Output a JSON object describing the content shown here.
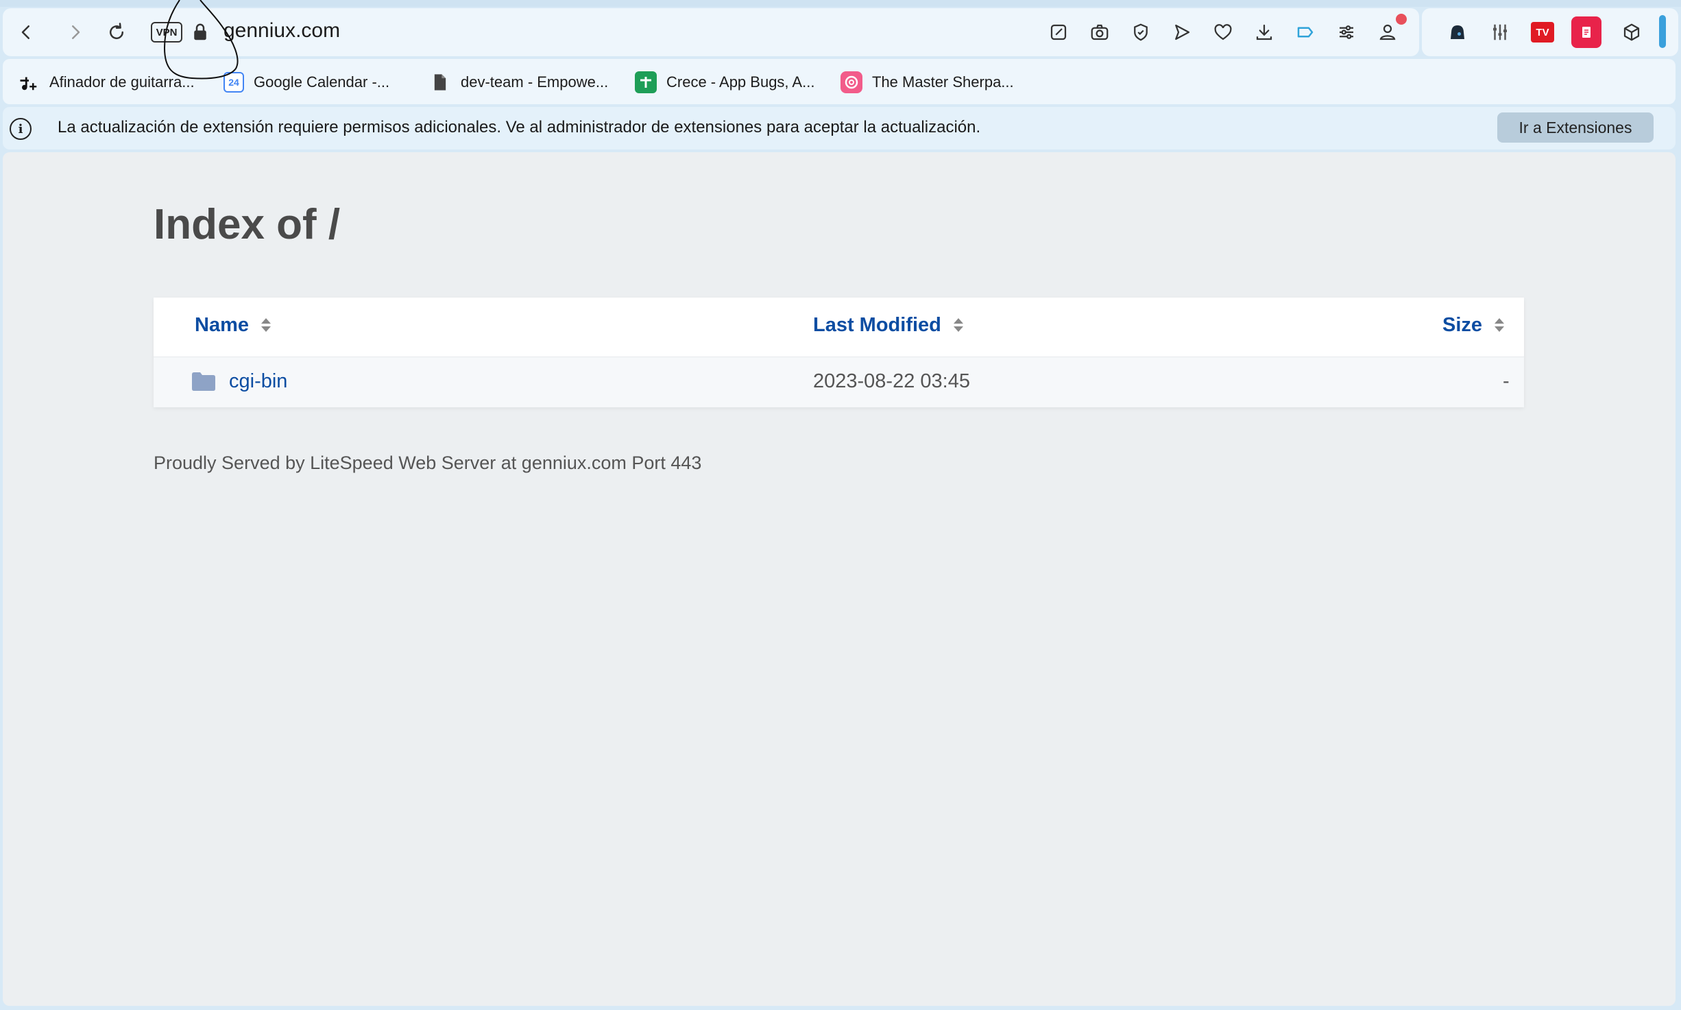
{
  "browser": {
    "url": "genniux.com",
    "vpn_label": "VPN",
    "bookmarks": [
      {
        "label": "Afinador de guitarra...",
        "icon": "music-icon"
      },
      {
        "label": "Google Calendar -...",
        "icon": "calendar-icon"
      },
      {
        "label": "dev-team - Empowe...",
        "icon": "document-icon"
      },
      {
        "label": "Crece - App Bugs, A...",
        "icon": "sheets-icon"
      },
      {
        "label": "The Master Sherpa...",
        "icon": "lifebuoy-icon"
      }
    ],
    "calendar_day": "24",
    "extension_tv": "TV",
    "infobar": {
      "message": "La actualización de extensión requiere permisos adicionales. Ve al administrador de extensiones para aceptar la actualización.",
      "button": "Ir a Extensiones"
    }
  },
  "page": {
    "title": "Index of /",
    "columns": {
      "name": "Name",
      "modified": "Last Modified",
      "size": "Size"
    },
    "rows": [
      {
        "name": "cgi-bin",
        "modified": "2023-08-22 03:45",
        "size": "-"
      }
    ],
    "footer": "Proudly Served by LiteSpeed Web Server at genniux.com Port 443"
  },
  "colors": {
    "link": "#0c4da2",
    "accent_red": "#e8505b"
  }
}
